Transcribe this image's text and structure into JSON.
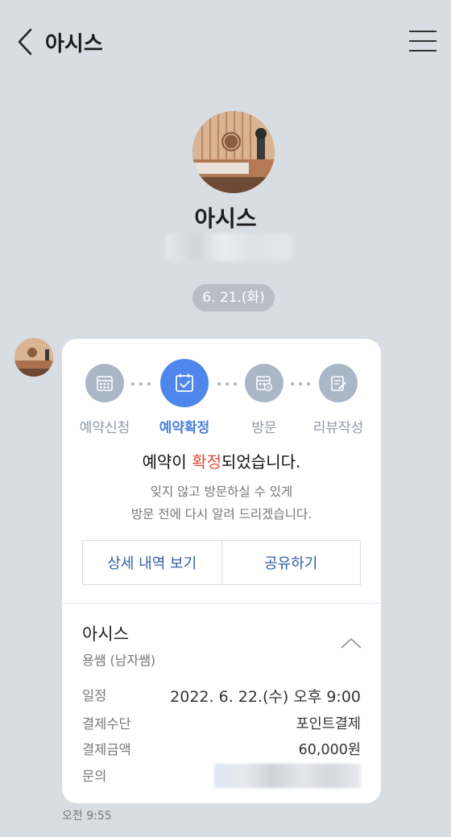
{
  "header": {
    "title": "아시스"
  },
  "profile": {
    "name": "아시스"
  },
  "date_pill": "6. 21.(화)",
  "card": {
    "steps": [
      {
        "label": "예약신청",
        "icon": "calendar-icon",
        "active": false
      },
      {
        "label": "예약확정",
        "icon": "calendar-check-icon",
        "active": true
      },
      {
        "label": "방문",
        "icon": "calendar-visit-icon",
        "active": false
      },
      {
        "label": "리뷰작성",
        "icon": "review-write-icon",
        "active": false
      }
    ],
    "confirm_prefix": "예약이 ",
    "confirm_highlight": "확정",
    "confirm_suffix": "되었습니다.",
    "sub_line1": "잊지 않고 방문하실 수 있게",
    "sub_line2": "방문 전에 다시 알려 드리겠습니다.",
    "detail_button": "상세 내역 보기",
    "share_button": "공유하기",
    "shop_name": "아시스",
    "shop_sub": "용쌤 (남자쌤)",
    "info": [
      {
        "key": "일정",
        "value": "2022. 6. 22.(수) 오후 9:00"
      },
      {
        "key": "결제수단",
        "value": "포인트결제"
      },
      {
        "key": "결제금액",
        "value": "60,000원"
      },
      {
        "key": "문의",
        "value": ""
      }
    ]
  },
  "timestamp": "오전 9:55",
  "colors": {
    "background": "#d8dde3",
    "accent": "#4f86ec",
    "highlight": "#e04a3c",
    "button_text": "#2f5ea8"
  }
}
